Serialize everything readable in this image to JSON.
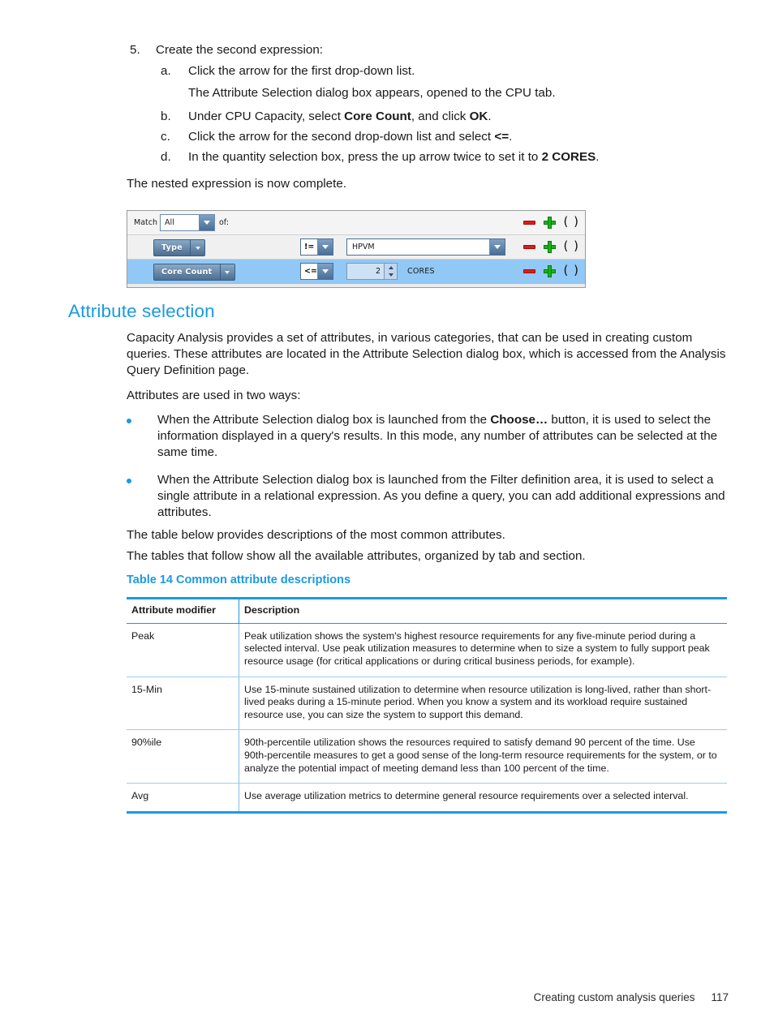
{
  "procedure": {
    "number": "5.",
    "title": "Create the second expression:",
    "steps": [
      {
        "letter": "a.",
        "text_html": "Click the arrow for the first drop-down list.",
        "continuation": "The Attribute Selection dialog box appears, opened to the CPU tab."
      },
      {
        "letter": "b.",
        "text_html": "Under CPU Capacity, select <b>Core Count</b>, and click <b>OK</b>."
      },
      {
        "letter": "c.",
        "text_html": "Click the arrow for the second drop-down list and select <b>&lt;=</b>."
      },
      {
        "letter": "d.",
        "text_html": "In the quantity selection box, press the up arrow twice to set it to <b>2 CORES</b>."
      }
    ],
    "closing": "The nested expression is now complete."
  },
  "widget": {
    "match_label": "Match",
    "match_value": "All",
    "match_suffix": "of:",
    "rows": [
      {
        "attribute": "Type",
        "operator": "!=",
        "value": "HPVM",
        "kind": "combo"
      },
      {
        "attribute": "Core Count",
        "operator": "<=",
        "value": "2",
        "unit": "CORES",
        "kind": "spinner"
      }
    ],
    "actions": {
      "remove": "remove-row",
      "add": "add-row",
      "group": "( )"
    },
    "colors": {
      "selected_row": "#91c8f5",
      "attribute_button": "#4b6e92",
      "add_icon": "#19b319",
      "remove_icon": "#e01b1b"
    }
  },
  "section": {
    "heading": "Attribute selection",
    "paragraph_1": "Capacity Analysis provides a set of attributes, in various categories, that can be used in creating custom queries. These attributes are located in the Attribute Selection dialog box, which is accessed from the Analysis Query Definition page.",
    "paragraph_2": "Attributes are used in two ways:",
    "bullets": [
      "When the Attribute Selection dialog box is launched from the <b>Choose…</b> button, it is used to select the information displayed in a query's results. In this mode, any number of attributes can be selected at the same time.",
      "When the Attribute Selection dialog box is launched from the Filter definition area, it is used to select a single attribute in a relational expression. As you define a query, you can add additional expressions and attributes."
    ],
    "paragraph_3": "The table below provides descriptions of the most common attributes.",
    "paragraph_4": "The tables that follow show all the available attributes, organized by tab and section."
  },
  "table": {
    "caption": "Table 14 Common attribute descriptions",
    "headers": [
      "Attribute modifier",
      "Description"
    ],
    "rows": [
      {
        "modifier": "Peak",
        "description": "Peak utilization shows the system's highest resource requirements for any five-minute period during a selected interval. Use peak utilization measures to determine when to size a system to fully support peak resource usage (for critical applications or during critical business periods, for example)."
      },
      {
        "modifier": "15-Min",
        "description": "Use 15-minute sustained utilization to determine when resource utilization is long-lived, rather than short-lived peaks during a 15-minute period. When you know a system and its workload require sustained resource use, you can size the system to support this demand."
      },
      {
        "modifier": "90%ile",
        "description": "90th-percentile utilization shows the resources required to satisfy demand 90 percent of the time. Use 90th-percentile measures to get a good sense of the long-term resource requirements for the system, or to analyze the potential impact of meeting demand less than 100 percent of the time."
      },
      {
        "modifier": "Avg",
        "description": "Use average utilization metrics to determine general resource requirements over a selected interval."
      }
    ],
    "accent_color": "#1b9ae0"
  },
  "footer": {
    "chapter": "Creating custom analysis queries",
    "page_number": "117"
  }
}
